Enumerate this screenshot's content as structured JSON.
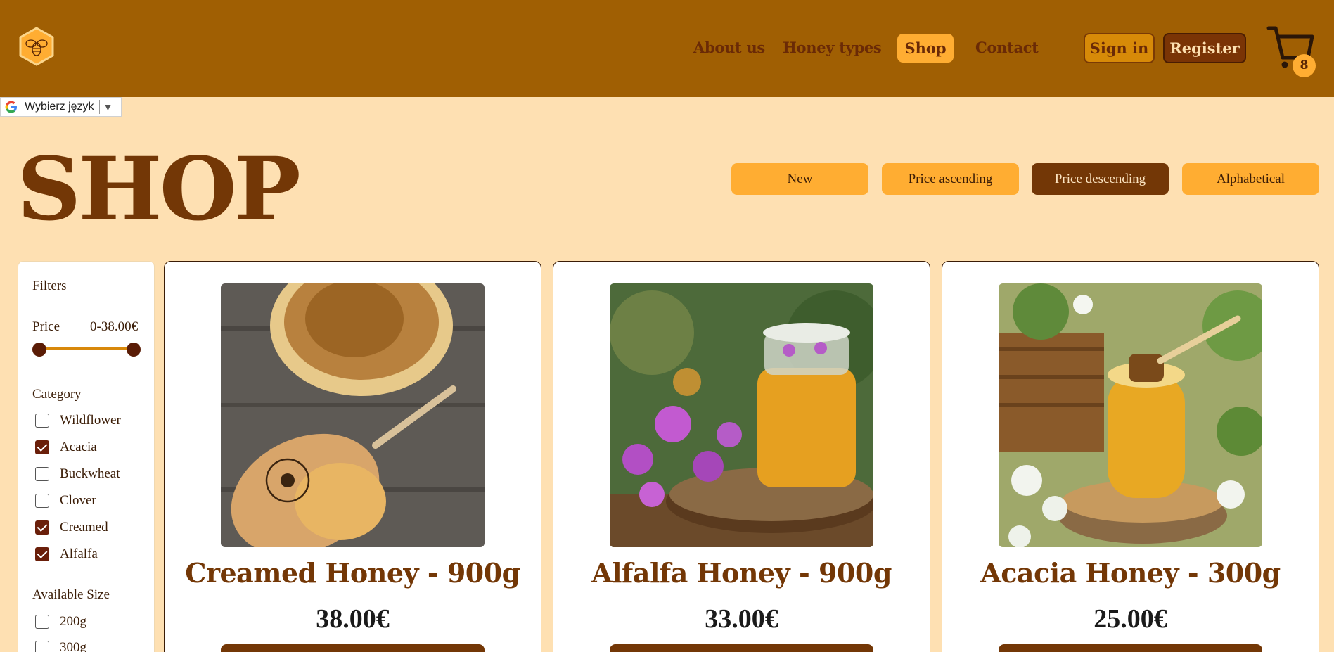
{
  "nav": {
    "links": [
      "About us",
      "Honey types",
      "Shop",
      "Contact"
    ],
    "active": "Shop",
    "sign_in": "Sign in",
    "register": "Register",
    "cart_count": "8"
  },
  "translate": {
    "label": "Wybierz język",
    "arrow": "▼"
  },
  "page": {
    "title": "SHOP"
  },
  "sort": {
    "options": [
      "New",
      "Price ascending",
      "Price descending",
      "Alphabetical"
    ],
    "active": "Price descending"
  },
  "filters": {
    "heading": "Filters",
    "price_label": "Price",
    "price_range": "0-38.00€",
    "category_label": "Category",
    "categories": [
      {
        "label": "Wildflower",
        "checked": false
      },
      {
        "label": "Acacia",
        "checked": true
      },
      {
        "label": "Buckwheat",
        "checked": false
      },
      {
        "label": "Clover",
        "checked": false
      },
      {
        "label": "Creamed",
        "checked": true
      },
      {
        "label": "Alfalfa",
        "checked": true
      }
    ],
    "size_label": "Available Size",
    "sizes": [
      {
        "label": "200g",
        "checked": false
      },
      {
        "label": "300g",
        "checked": false
      }
    ]
  },
  "products": [
    {
      "name": "Creamed Honey - 900g",
      "price": "38.00€"
    },
    {
      "name": "Alfalfa Honey - 900g",
      "price": "33.00€"
    },
    {
      "name": "Acacia Honey - 300g",
      "price": "25.00€"
    }
  ],
  "colors": {
    "header": "#a05f03",
    "background": "#fee0b2",
    "accent": "#ffad32",
    "brown": "#733706"
  }
}
